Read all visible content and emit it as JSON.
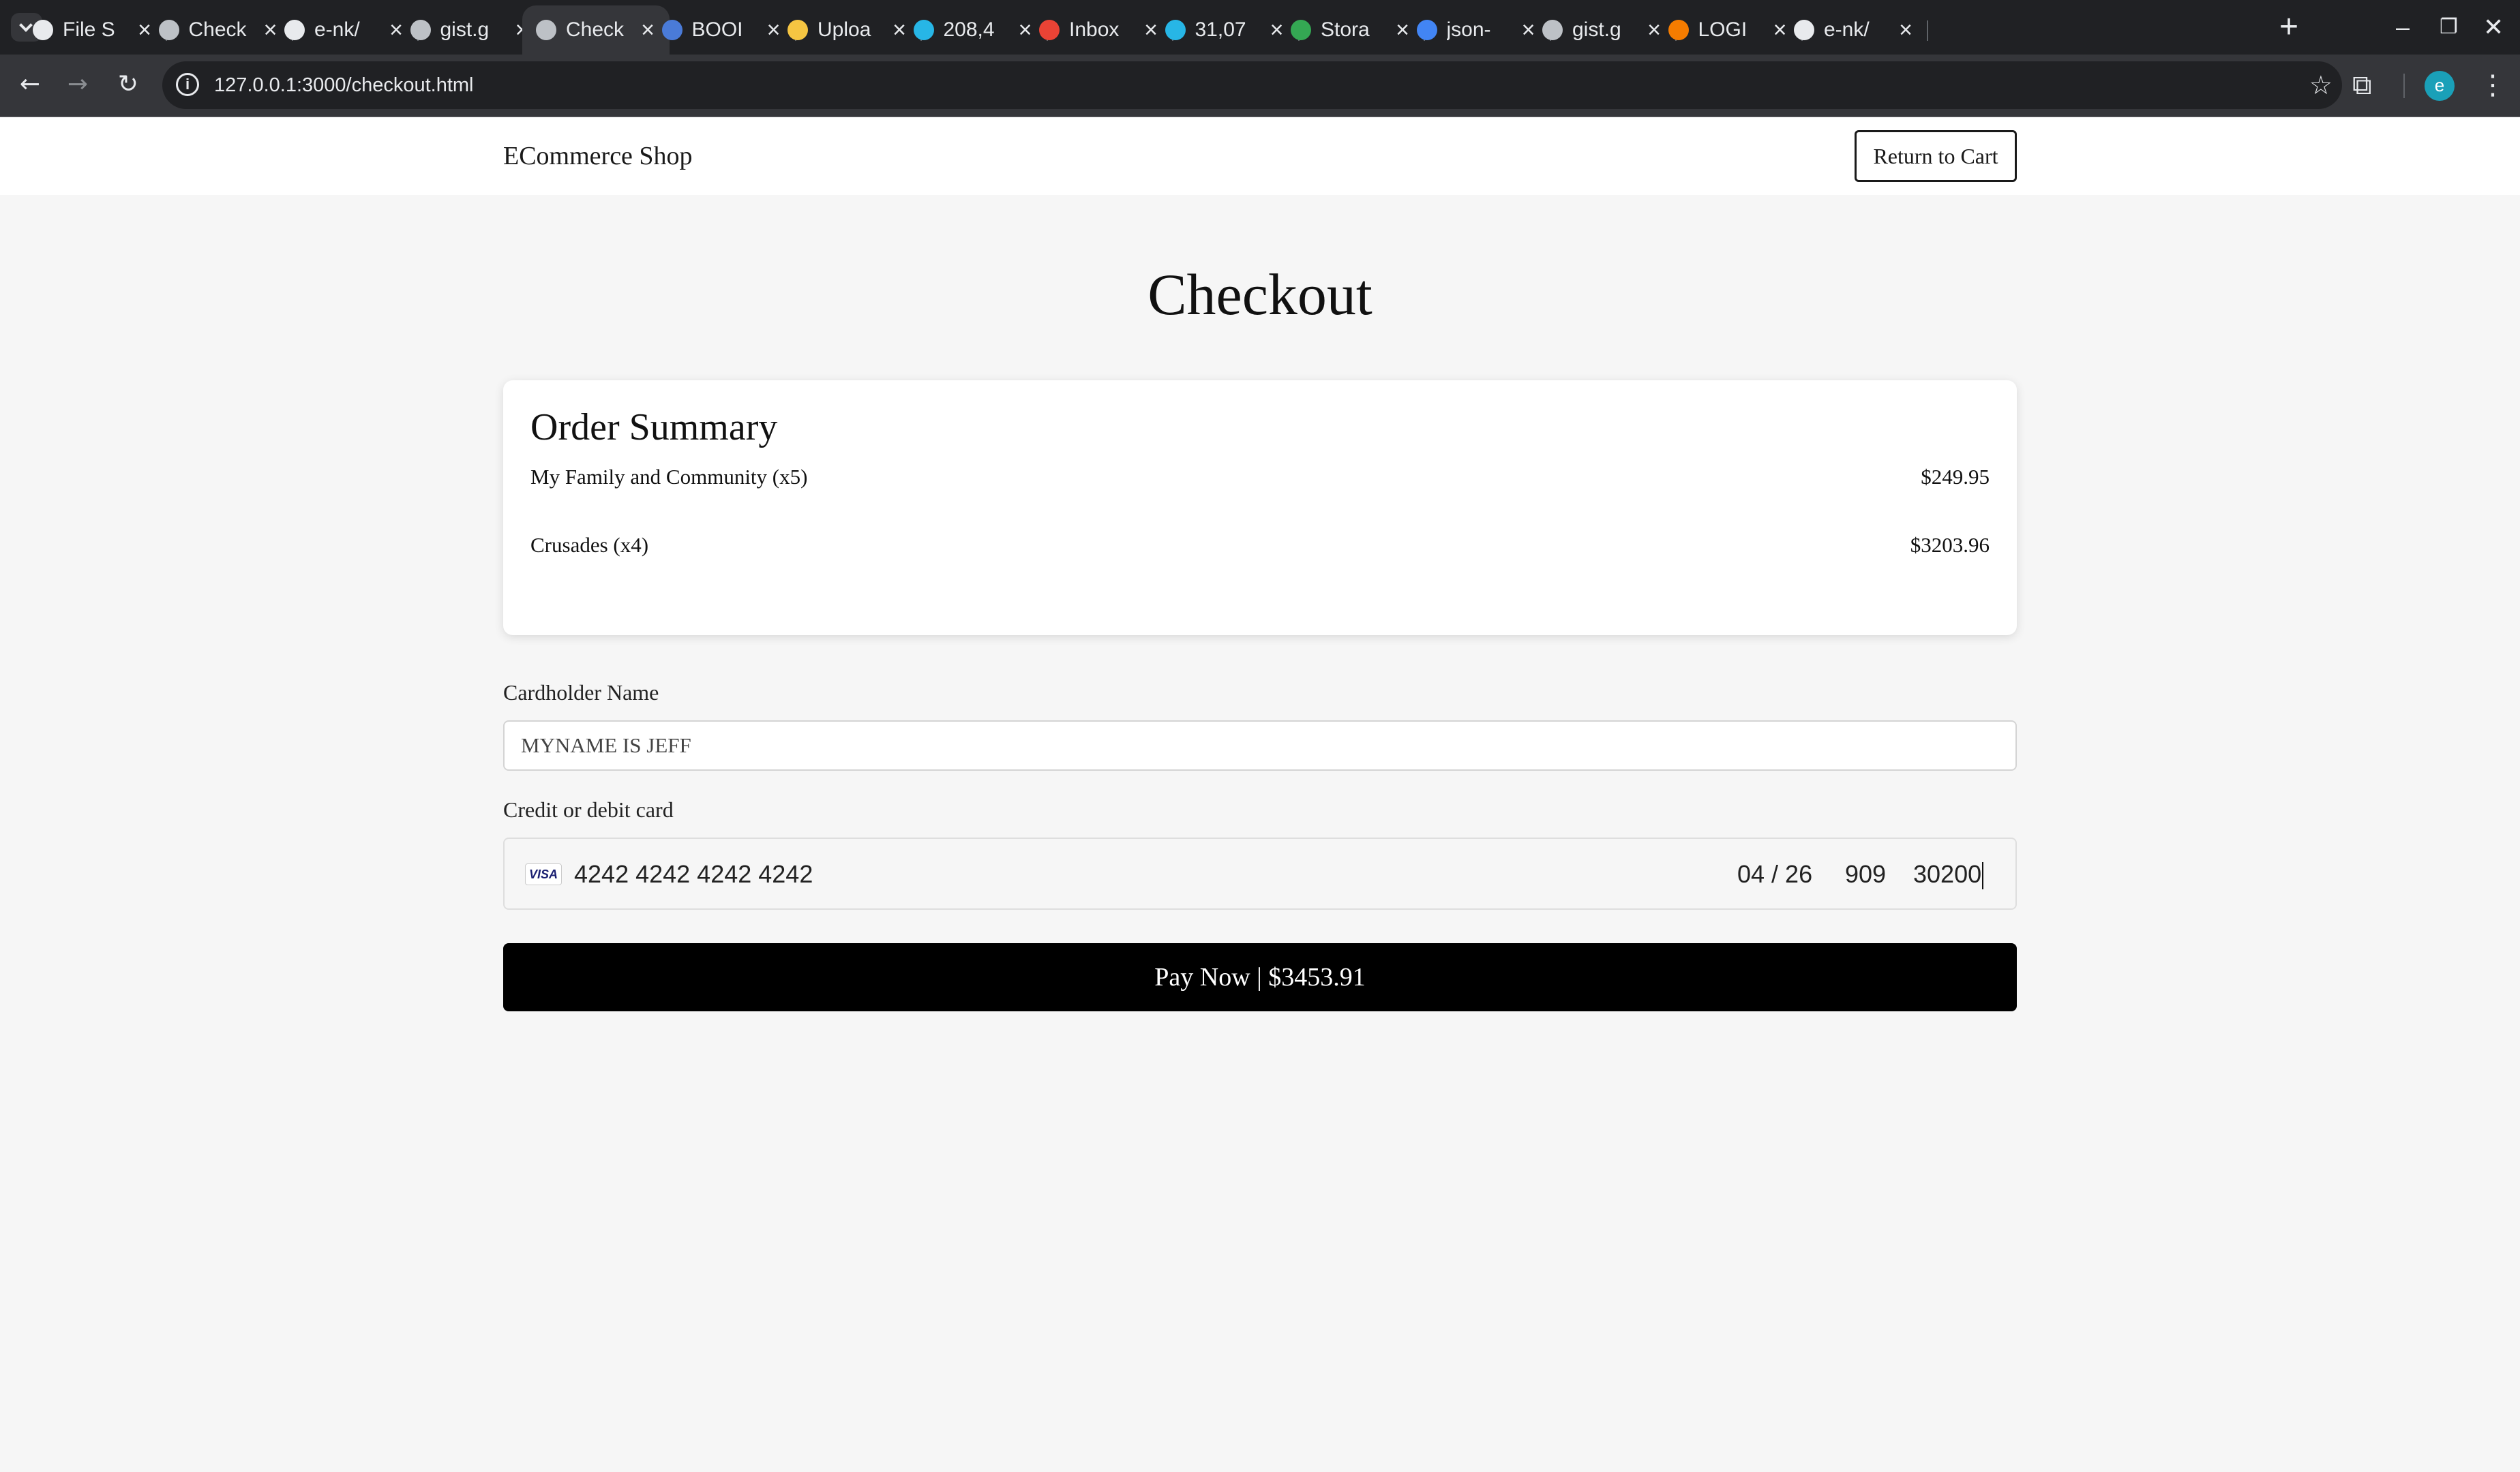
{
  "browser": {
    "tabs": [
      {
        "title": "File S",
        "icon": "openai-icon",
        "color": "#e8eaed"
      },
      {
        "title": "Check",
        "icon": "globe-icon",
        "color": "#bdc1c6"
      },
      {
        "title": "e-nk/",
        "icon": "github-icon",
        "color": "#e8eaed"
      },
      {
        "title": "gist.g",
        "icon": "globe-icon",
        "color": "#bdc1c6"
      },
      {
        "title": "Check",
        "icon": "globe-icon",
        "color": "#bdc1c6",
        "active": true
      },
      {
        "title": "BOOI",
        "icon": "booi-icon",
        "color": "#4a7bd8"
      },
      {
        "title": "Uploa",
        "icon": "upload-icon",
        "color": "#f5c542"
      },
      {
        "title": "208,4",
        "icon": "search-circle-icon",
        "color": "#27b6e6"
      },
      {
        "title": "Inbox",
        "icon": "gmail-icon",
        "color": "#ea4335"
      },
      {
        "title": "31,07",
        "icon": "search-circle-icon",
        "color": "#27b6e6"
      },
      {
        "title": "Stora",
        "icon": "drive-icon",
        "color": "#34a853"
      },
      {
        "title": "json-",
        "icon": "google-icon",
        "color": "#4285f4"
      },
      {
        "title": "gist.g",
        "icon": "openai-icon",
        "color": "#bdc1c6"
      },
      {
        "title": "LOGI",
        "icon": "firebase-icon",
        "color": "#f57c00"
      },
      {
        "title": "e-nk/",
        "icon": "github-icon",
        "color": "#e8eaed"
      }
    ],
    "url": "127.0.0.1:3000/checkout.html",
    "profile_initial": "e"
  },
  "header": {
    "brand": "ECommerce Shop",
    "return_label": "Return to Cart"
  },
  "page": {
    "title": "Checkout"
  },
  "summary": {
    "heading": "Order Summary",
    "items": [
      {
        "name": "My Family and Community (x5)",
        "price": "$249.95"
      },
      {
        "name": "Crusades (x4)",
        "price": "$3203.96"
      }
    ]
  },
  "form": {
    "cardholder_label": "Cardholder Name",
    "cardholder_value": "MYNAME IS JEFF",
    "card_label": "Credit or debit card",
    "card_brand": "VISA",
    "card_number": "4242 4242 4242 4242",
    "card_expiry": "04 / 26",
    "card_cvc": "909",
    "card_zip": "30200"
  },
  "pay": {
    "label": "Pay Now | $3453.91"
  }
}
